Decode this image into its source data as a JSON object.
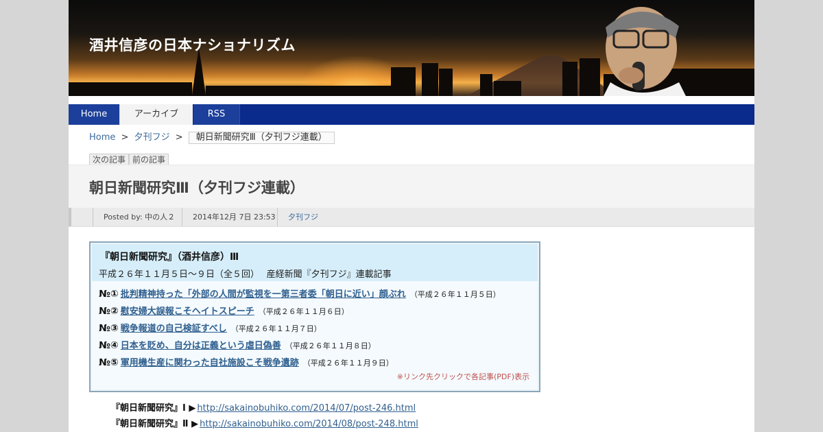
{
  "site": {
    "title": "酒井信彦の日本ナショナリズム"
  },
  "nav": {
    "home": "Home",
    "archive": "アーカイブ",
    "rss": "RSS"
  },
  "breadcrumb": {
    "home": "Home",
    "sep1": ">",
    "category": "夕刊フジ",
    "sep2": ">",
    "current": "朝日新聞研究Ⅲ（夕刊フジ連載）"
  },
  "pager": {
    "next": "次の記事",
    "prev": "前の記事"
  },
  "post": {
    "title": "朝日新聞研究Ⅲ（夕刊フジ連載）",
    "meta": {
      "posted_by": "Posted by: 中の人２",
      "date": "2014年12月 7日 23:53",
      "category": "夕刊フジ"
    }
  },
  "series_box": {
    "heading": "『朝日新聞研究』（酒井信彦）Ⅲ",
    "subheading": "平成２６年１１月５日～９日（全５回）　 産経新聞『夕刊フジ』連載記事",
    "items": [
      {
        "no": "№①",
        "title": "批判精神持った「外部の人間が監視を一第三者委「朝日に近い」顔ぶれ",
        "date": "（平成２６年１１月５日）"
      },
      {
        "no": "№②",
        "title": "慰安婦大誤報こそヘイトスピーチ",
        "date": "（平成２６年１１月６日）"
      },
      {
        "no": "№③",
        "title": "戦争報道の自己検証すべし",
        "date": "（平成２６年１１月７日）"
      },
      {
        "no": "№④",
        "title": "日本を貶め、自分は正義という虐日偽善",
        "date": "（平成２６年１１月８日）"
      },
      {
        "no": "№⑤",
        "title": "軍用機生産に関わった自社施設こそ戦争遺跡",
        "date": "（平成２６年１１月９日）"
      }
    ],
    "note": "※リンク先クリックで各記事(PDF)表示"
  },
  "previous_series": [
    {
      "label": "『朝日新聞研究』Ⅰ ▶",
      "url": "http://sakainobuhiko.com/2014/07/post-246.html"
    },
    {
      "label": "『朝日新聞研究』Ⅱ ▶",
      "url": "http://sakainobuhiko.com/2014/08/post-248.html"
    }
  ],
  "colors": {
    "nav_bg": "#0a2a8c",
    "link": "#2f5f8f",
    "note": "#c0504d",
    "box_border": "#8da6b6"
  }
}
